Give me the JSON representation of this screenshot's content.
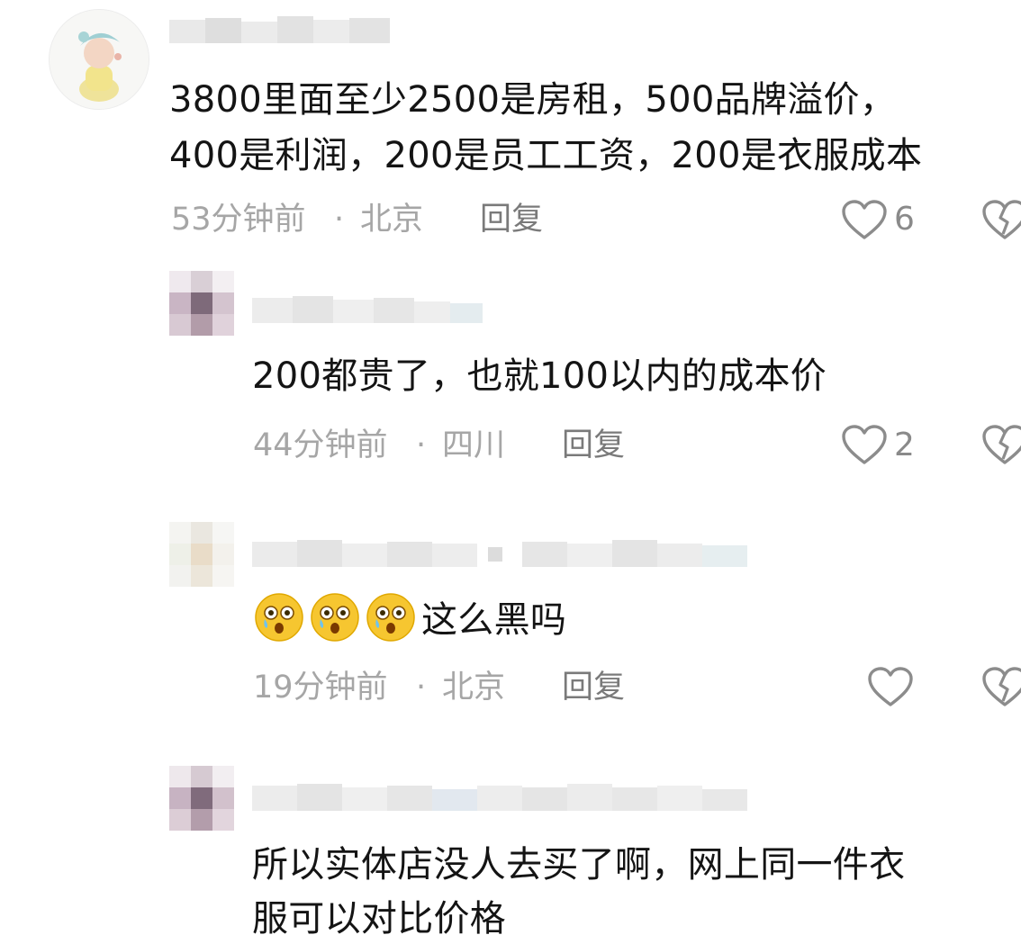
{
  "comments": [
    {
      "lines": [
        "3800里面至少2500是房租，500品牌溢价，",
        "400是利润，200是员工工资，200是衣服成本"
      ],
      "time": "53分钟前",
      "separator": "·",
      "location": "北京",
      "reply_label": "回复",
      "likes": "6"
    },
    {
      "lines": [
        "200都贵了，也就100以内的成本价"
      ],
      "time": "44分钟前",
      "separator": "·",
      "location": "四川",
      "reply_label": "回复",
      "likes": "2"
    },
    {
      "emoji_count": 3,
      "lines": [
        "这么黑吗"
      ],
      "time": "19分钟前",
      "separator": "·",
      "location": "北京",
      "reply_label": "回复",
      "likes": ""
    },
    {
      "lines": [
        "所以实体店没人去买了啊，网上同一件衣",
        "服可以对比价格"
      ]
    }
  ],
  "colors": {
    "text": "#141414",
    "meta": "#a6a6a6",
    "reply": "#7a7a7a",
    "icon": "#8c8c8c",
    "emoji_yellow": "#f6c630"
  },
  "icons": {
    "like": "heart-outline-icon",
    "dislike": "broken-heart-icon",
    "emoji": "shocked-tearful-face-emoji"
  }
}
